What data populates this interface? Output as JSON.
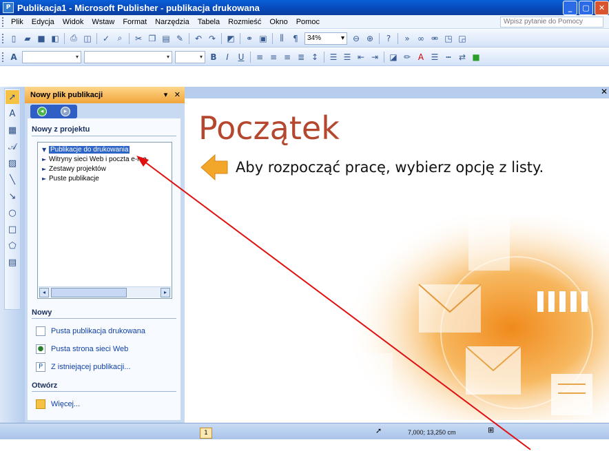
{
  "window": {
    "title": "Publikacja1 - Microsoft Publisher - publikacja drukowana",
    "app_icon": "publisher-icon",
    "buttons": [
      "minimize",
      "maximize",
      "close"
    ]
  },
  "menubar": {
    "items": [
      "Plik",
      "Edycja",
      "Widok",
      "Wstaw",
      "Format",
      "Narzędzia",
      "Tabela",
      "Rozmieść",
      "Okno",
      "Pomoc"
    ],
    "help_placeholder": "Wpisz pytanie do Pomocy"
  },
  "toolbar_standard": {
    "zoom": "34%"
  },
  "taskpane": {
    "title": "Nowy plik publikacji",
    "section_new_from_design": "Nowy z projektu",
    "tree_items": [
      "Publikacje do drukowania",
      "Witryny sieci Web i poczta e-ma",
      "Zestawy projektów",
      "Puste publikacje"
    ],
    "section_new": "Nowy",
    "new_links": [
      "Pusta publikacja drukowana",
      "Pusta strona sieci Web",
      "Z istniejącej publikacji..."
    ],
    "section_open": "Otwórz",
    "open_link": "Więcej..."
  },
  "document": {
    "title": "Początek",
    "subtitle": "Aby rozpocząć pracę, wybierz opcję z listy.",
    "accent_color": "#b5472f"
  },
  "statusbar": {
    "page": "1",
    "coordinates": "7,000; 13,250 cm"
  },
  "colors": {
    "titlebar": "#0848b8",
    "taskpane_header": "#f0a43a",
    "annotation_arrow": "#e01010"
  }
}
